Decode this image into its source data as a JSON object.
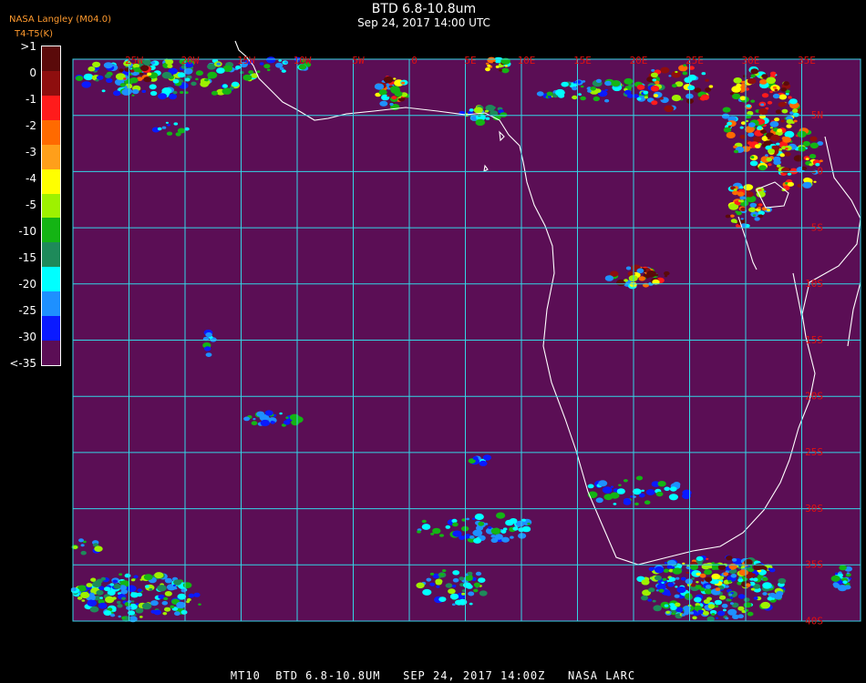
{
  "title": "BTD 6.8-10.8um",
  "subtitle": "Sep 24, 2017 14:00 UTC",
  "source_line1": "NASA Langley (M04.0)",
  "source_line2": "T4-T5(K)",
  "legend": {
    "labels": [
      ">1",
      "0",
      "-1",
      "-2",
      "-3",
      "-4",
      "-5",
      "-10",
      "-15",
      "-20",
      "-25",
      "-30",
      "<-35"
    ],
    "colors": [
      "#5a0a0a",
      "#8e0e0e",
      "#ff1b1b",
      "#ff6a00",
      "#ff9f1a",
      "#ffff00",
      "#9ef100",
      "#14b414",
      "#1e8a5a",
      "#00ffff",
      "#1e90ff",
      "#0a1aff",
      "#5b0e55"
    ]
  },
  "longitude_labels": [
    "25W",
    "20W",
    "15W",
    "10W",
    "5W",
    "0",
    "5E",
    "10E",
    "15E",
    "20E",
    "25E",
    "30E",
    "35E"
  ],
  "latitude_labels": [
    "5N",
    "0",
    "5S",
    "10S",
    "15S",
    "20S",
    "25S",
    "30S",
    "35S",
    "40S"
  ],
  "colors": {
    "background": "#5b0e55",
    "grid": "#33d6e6",
    "coast": "#ffffff",
    "label": "#e01010"
  },
  "footer": "MT10  BTD 6.8-10.8UM   SEP 24, 2017 14:00Z   NASA LARC"
}
